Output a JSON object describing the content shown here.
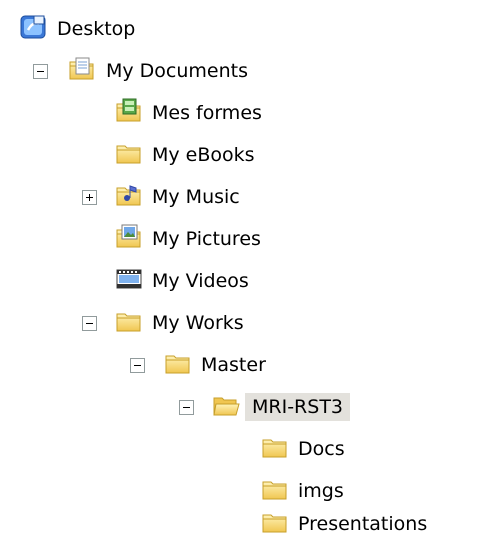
{
  "tree": {
    "desktop": {
      "label": "Desktop",
      "icon": "desktop-icon"
    },
    "my_documents": {
      "label": "My Documents",
      "icon": "documents-folder-icon",
      "expanded": true
    },
    "mes_formes": {
      "label": "Mes formes",
      "icon": "shapes-folder-icon"
    },
    "my_ebooks": {
      "label": "My eBooks",
      "icon": "folder-icon"
    },
    "my_music": {
      "label": "My Music",
      "icon": "music-folder-icon",
      "expanded": false
    },
    "my_pictures": {
      "label": "My Pictures",
      "icon": "pictures-folder-icon"
    },
    "my_videos": {
      "label": "My Videos",
      "icon": "videos-folder-icon"
    },
    "my_works": {
      "label": "My Works",
      "icon": "folder-icon",
      "expanded": true
    },
    "master": {
      "label": "Master",
      "icon": "folder-icon",
      "expanded": true
    },
    "mri_rst3": {
      "label": "MRI-RST3",
      "icon": "open-folder-icon",
      "expanded": true,
      "selected": true
    },
    "docs": {
      "label": "Docs",
      "icon": "folder-icon"
    },
    "imgs": {
      "label": "imgs",
      "icon": "folder-icon"
    },
    "presentations": {
      "label": "Presentations",
      "icon": "folder-icon"
    }
  },
  "colors": {
    "folder": "#f3d36b",
    "folder_dark": "#c79f2a",
    "selection": "#e3e1dc"
  }
}
